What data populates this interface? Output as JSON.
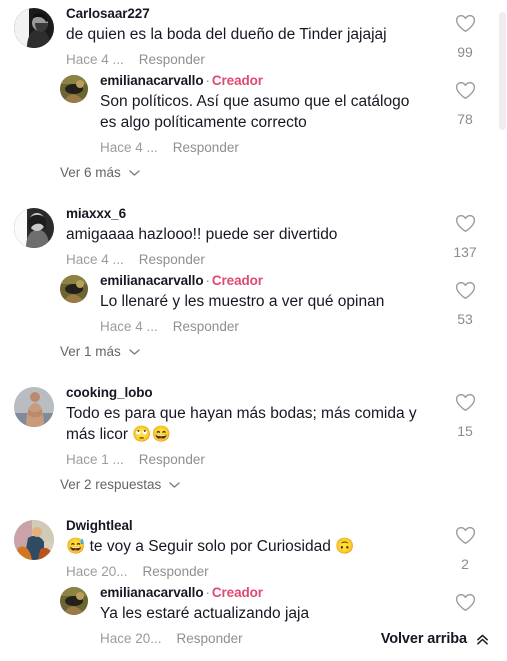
{
  "colors": {
    "text": "#161823",
    "muted": "#8a8b91",
    "creator_tag": "#e04a72",
    "background": "#ffffff",
    "scrollbar_thumb": "#eeeeee"
  },
  "labels": {
    "reply": "Responder",
    "separator": "·",
    "creator": "Creador"
  },
  "comments": [
    {
      "username": "Carlosaar227",
      "text": "de quien es la boda del dueño de Tinder jajajaj",
      "time": "Hace 4 ...",
      "reply_label": "Responder",
      "likes": "99",
      "avatar": "man-beard-grayscale-avatar",
      "reply": {
        "username": "emilianacarvallo",
        "creator_tag": "Creador",
        "text": "Son políticos. Así que asumo que el catálogo es algo políticamente correcto",
        "time": "Hace 4 ...",
        "reply_label": "Responder",
        "likes": "78",
        "avatar": "creator-olive-avatar"
      },
      "view_more": "Ver 6 más"
    },
    {
      "username": "miaxxx_6",
      "text": "amigaaaa hazlooo!! puede ser divertido",
      "time": "Hace 4 ...",
      "reply_label": "Responder",
      "likes": "137",
      "avatar": "woman-grayscale-avatar",
      "reply": {
        "username": "emilianacarvallo",
        "creator_tag": "Creador",
        "text": "Lo llenaré y les muestro a ver qué opinan",
        "time": "Hace 4 ...",
        "reply_label": "Responder",
        "likes": "53",
        "avatar": "creator-olive-avatar"
      },
      "view_more": "Ver 1 más"
    },
    {
      "username": "cooking_lobo",
      "text": "Todo es para que hayan más bodas; más comida y más licor 🙄😄",
      "time": "Hace 1 ...",
      "reply_label": "Responder",
      "likes": "15",
      "avatar": "shirtless-man-avatar",
      "reply": null,
      "view_more": "Ver 2 respuestas"
    },
    {
      "username": "Dwightleal",
      "text": "😅 te voy a Seguir solo por Curiosidad 🙃",
      "time": "Hace 20...",
      "reply_label": "Responder",
      "likes": "2",
      "avatar": "colorful-photo-avatar",
      "reply": {
        "username": "emilianacarvallo",
        "creator_tag": "Creador",
        "text": "Ya les estaré actualizando jaja",
        "time": "Hace 20...",
        "reply_label": "Responder",
        "likes": "",
        "avatar": "creator-olive-avatar"
      },
      "view_more": null
    }
  ],
  "back_to_top": {
    "label": "Volver arriba",
    "icon": "chevron-double-up-icon"
  }
}
